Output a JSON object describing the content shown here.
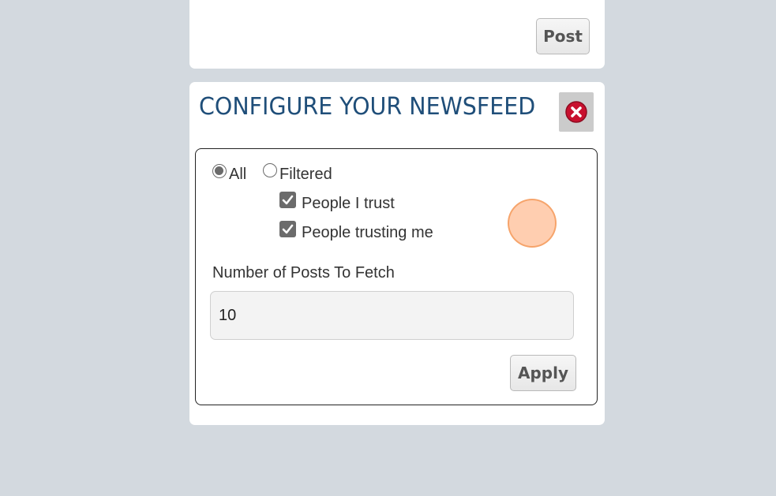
{
  "post_card": {
    "post_label": "Post"
  },
  "newsfeed_config": {
    "title": "CONFIGURE YOUR NEWSFEED",
    "close_icon": "close-circle-icon",
    "filter_mode": {
      "options": [
        {
          "label": "All",
          "checked": true
        },
        {
          "label": "Filtered",
          "checked": false
        }
      ]
    },
    "filters": [
      {
        "label": "People I trust",
        "checked": true
      },
      {
        "label": "People trusting me",
        "checked": true
      }
    ],
    "posts_count": {
      "label": "Number of Posts To Fetch",
      "value": "10"
    },
    "apply_label": "Apply"
  },
  "colors": {
    "page_background": "#d3d9df",
    "card_background": "#ffffff",
    "title_color": "#1f4e79",
    "close_icon_red": "#c8102e",
    "checkbox_gray": "#6b6b6b",
    "cursor_highlight": "#ffbe96"
  }
}
